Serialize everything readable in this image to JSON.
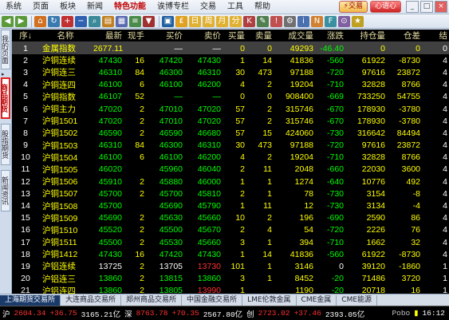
{
  "menu": {
    "items": [
      "系统",
      "页面",
      "板块",
      "新闻",
      "特色功能",
      "诶博专栏",
      "交易",
      "工具",
      "帮助"
    ],
    "active_index": 4,
    "trade_button": "⚡交易",
    "secondary_button": "心语心"
  },
  "left_tabs": [
    "我的页面",
    "商品期货",
    "股指期货",
    "新闻资讯"
  ],
  "table": {
    "headers": [
      "序↓",
      "名称",
      "最新",
      "现手",
      "买价",
      "卖价",
      "买量",
      "卖量",
      "成交量",
      "涨跌",
      "持仓量",
      "仓差",
      "结"
    ],
    "rows": [
      [
        "1",
        "金属指数",
        "2677.11",
        "",
        "—",
        "—",
        "0",
        "0",
        "49293",
        "-46.40",
        "0",
        "0",
        "0"
      ],
      [
        "2",
        "沪铜连续",
        "47430",
        "16",
        "47420",
        "47430",
        "1",
        "14",
        "41836",
        "-560",
        "61922",
        "-8730",
        "4"
      ],
      [
        "3",
        "沪铜连三",
        "46310",
        "84",
        "46300",
        "46310",
        "30",
        "473",
        "97188",
        "-720",
        "97616",
        "23872",
        "4"
      ],
      [
        "4",
        "沪铜连四",
        "46100",
        "6",
        "46100",
        "46200",
        "4",
        "2",
        "19204",
        "-710",
        "32828",
        "8766",
        "4"
      ],
      [
        "5",
        "沪铜指数",
        "46107",
        "52",
        "—",
        "—",
        "0",
        "0",
        "908400",
        "-669",
        "733250",
        "54755",
        "4"
      ],
      [
        "6",
        "沪铜主力",
        "47020",
        "2",
        "47010",
        "47020",
        "57",
        "2",
        "315746",
        "-670",
        "178930",
        "-3780",
        "4"
      ],
      [
        "7",
        "沪铜1501",
        "47020",
        "2",
        "47010",
        "47020",
        "57",
        "2",
        "315746",
        "-670",
        "178930",
        "-3780",
        "4"
      ],
      [
        "8",
        "沪铜1502",
        "46590",
        "2",
        "46590",
        "46680",
        "57",
        "15",
        "424060",
        "-730",
        "316642",
        "84494",
        "4"
      ],
      [
        "9",
        "沪铜1503",
        "46310",
        "84",
        "46300",
        "46310",
        "30",
        "473",
        "97188",
        "-720",
        "97616",
        "23872",
        "4"
      ],
      [
        "10",
        "沪铜1504",
        "46100",
        "6",
        "46100",
        "46200",
        "4",
        "2",
        "19204",
        "-710",
        "32828",
        "8766",
        "4"
      ],
      [
        "11",
        "沪铜1505",
        "46020",
        "",
        "45960",
        "46040",
        "2",
        "11",
        "2048",
        "-660",
        "22030",
        "3600",
        "4"
      ],
      [
        "12",
        "沪铜1506",
        "45910",
        "2",
        "45880",
        "46000",
        "1",
        "1",
        "1274",
        "-640",
        "10776",
        "492",
        "4"
      ],
      [
        "13",
        "沪铜1507",
        "45700",
        "2",
        "45700",
        "45810",
        "2",
        "1",
        "78",
        "-730",
        "3154",
        "-8",
        "4"
      ],
      [
        "14",
        "沪铜1508",
        "45700",
        "",
        "45690",
        "45790",
        "1",
        "11",
        "12",
        "-730",
        "3134",
        "-4",
        "4"
      ],
      [
        "15",
        "沪铜1509",
        "45690",
        "2",
        "45630",
        "45660",
        "10",
        "2",
        "196",
        "-690",
        "2590",
        "86",
        "4"
      ],
      [
        "16",
        "沪铜1510",
        "45520",
        "2",
        "45500",
        "45670",
        "2",
        "4",
        "54",
        "-720",
        "2226",
        "76",
        "4"
      ],
      [
        "17",
        "沪铜1511",
        "45500",
        "2",
        "45530",
        "45660",
        "3",
        "1",
        "394",
        "-710",
        "1662",
        "32",
        "4"
      ],
      [
        "18",
        "沪铜1412",
        "47430",
        "16",
        "47420",
        "47430",
        "1",
        "14",
        "41836",
        "-560",
        "61922",
        "-8730",
        "4"
      ],
      [
        "19",
        "沪铝连续",
        "13725",
        "2",
        "13705",
        "13730",
        "101",
        "1",
        "3146",
        "0",
        "39120",
        "-1860",
        "1"
      ],
      [
        "20",
        "沪铝连三",
        "13860",
        "2",
        "13815",
        "13860",
        "3",
        "1",
        "8452",
        "-20",
        "71486",
        "3720",
        "1"
      ],
      [
        "21",
        "沪铝连四",
        "13860",
        "2",
        "13805",
        "13990",
        "1",
        "",
        "1190",
        "-20",
        "20718",
        "16",
        "1"
      ]
    ]
  },
  "bottom_tabs": [
    "上海期货交易所",
    "大连商品交易所",
    "郑州商品交易所",
    "中国金融交易所",
    "LME伦敦金属",
    "CME金属",
    "CME能源"
  ],
  "status": {
    "sh_label": "沪",
    "sh_index": "2604.34",
    "sh_change": "+36.75",
    "sh_amount": "3165.21亿",
    "sz_label": "深",
    "sz_index": "8763.78",
    "sz_change": "+70.35",
    "sz_amount": "2567.80亿",
    "cyb_label": "创",
    "cyb_index": "2723.02",
    "cyb_change": "+37.46",
    "cyb_amount": "2393.05亿",
    "brand": "Pobo",
    "time": "16:12"
  }
}
